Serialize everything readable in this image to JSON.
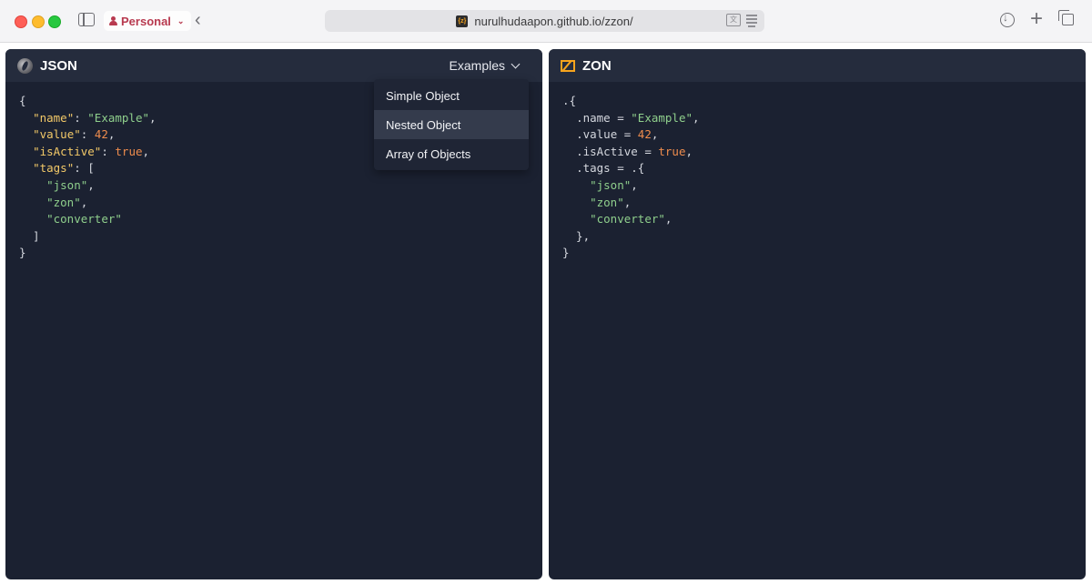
{
  "browser": {
    "profile": "Personal",
    "url": "nurulhudaapon.github.io/zzon/",
    "favicon_text": "{z}"
  },
  "left_panel": {
    "title": "JSON",
    "examples_label": "Examples",
    "code_lines": [
      [
        {
          "t": "p",
          "v": "{"
        }
      ],
      [
        {
          "t": "p",
          "v": "  "
        },
        {
          "t": "k",
          "v": "\"name\""
        },
        {
          "t": "p",
          "v": ": "
        },
        {
          "t": "s",
          "v": "\"Example\""
        },
        {
          "t": "p",
          "v": ","
        }
      ],
      [
        {
          "t": "p",
          "v": "  "
        },
        {
          "t": "k",
          "v": "\"value\""
        },
        {
          "t": "p",
          "v": ": "
        },
        {
          "t": "n",
          "v": "42"
        },
        {
          "t": "p",
          "v": ","
        }
      ],
      [
        {
          "t": "p",
          "v": "  "
        },
        {
          "t": "k",
          "v": "\"isActive\""
        },
        {
          "t": "p",
          "v": ": "
        },
        {
          "t": "b",
          "v": "true"
        },
        {
          "t": "p",
          "v": ","
        }
      ],
      [
        {
          "t": "p",
          "v": "  "
        },
        {
          "t": "k",
          "v": "\"tags\""
        },
        {
          "t": "p",
          "v": ": ["
        }
      ],
      [
        {
          "t": "p",
          "v": "    "
        },
        {
          "t": "s",
          "v": "\"json\""
        },
        {
          "t": "p",
          "v": ","
        }
      ],
      [
        {
          "t": "p",
          "v": "    "
        },
        {
          "t": "s",
          "v": "\"zon\""
        },
        {
          "t": "p",
          "v": ","
        }
      ],
      [
        {
          "t": "p",
          "v": "    "
        },
        {
          "t": "s",
          "v": "\"converter\""
        }
      ],
      [
        {
          "t": "p",
          "v": "  ]"
        }
      ],
      [
        {
          "t": "p",
          "v": "}"
        }
      ]
    ]
  },
  "examples_menu": {
    "items": [
      "Simple Object",
      "Nested Object",
      "Array of Objects"
    ],
    "hovered_index": 1
  },
  "right_panel": {
    "title": "ZON",
    "code_lines": [
      [
        {
          "t": "p",
          "v": ".{"
        }
      ],
      [
        {
          "t": "p",
          "v": "  "
        },
        {
          "t": "f",
          "v": ".name"
        },
        {
          "t": "p",
          "v": " = "
        },
        {
          "t": "s",
          "v": "\"Example\""
        },
        {
          "t": "p",
          "v": ","
        }
      ],
      [
        {
          "t": "p",
          "v": "  "
        },
        {
          "t": "f",
          "v": ".value"
        },
        {
          "t": "p",
          "v": " = "
        },
        {
          "t": "n",
          "v": "42"
        },
        {
          "t": "p",
          "v": ","
        }
      ],
      [
        {
          "t": "p",
          "v": "  "
        },
        {
          "t": "f",
          "v": ".isActive"
        },
        {
          "t": "p",
          "v": " = "
        },
        {
          "t": "b",
          "v": "true"
        },
        {
          "t": "p",
          "v": ","
        }
      ],
      [
        {
          "t": "p",
          "v": "  "
        },
        {
          "t": "f",
          "v": ".tags"
        },
        {
          "t": "p",
          "v": " = .{"
        }
      ],
      [
        {
          "t": "p",
          "v": "    "
        },
        {
          "t": "s",
          "v": "\"json\""
        },
        {
          "t": "p",
          "v": ","
        }
      ],
      [
        {
          "t": "p",
          "v": "    "
        },
        {
          "t": "s",
          "v": "\"zon\""
        },
        {
          "t": "p",
          "v": ","
        }
      ],
      [
        {
          "t": "p",
          "v": "    "
        },
        {
          "t": "s",
          "v": "\"converter\""
        },
        {
          "t": "p",
          "v": ","
        }
      ],
      [
        {
          "t": "p",
          "v": "  },"
        }
      ],
      [
        {
          "t": "p",
          "v": "}"
        }
      ]
    ]
  },
  "colors": {
    "panel_bg": "#1b2131",
    "header_bg": "#252c3d",
    "key": "#f3c968",
    "string": "#8fcf8c",
    "number": "#ee8c4d",
    "zon_accent": "#f7a41d"
  }
}
